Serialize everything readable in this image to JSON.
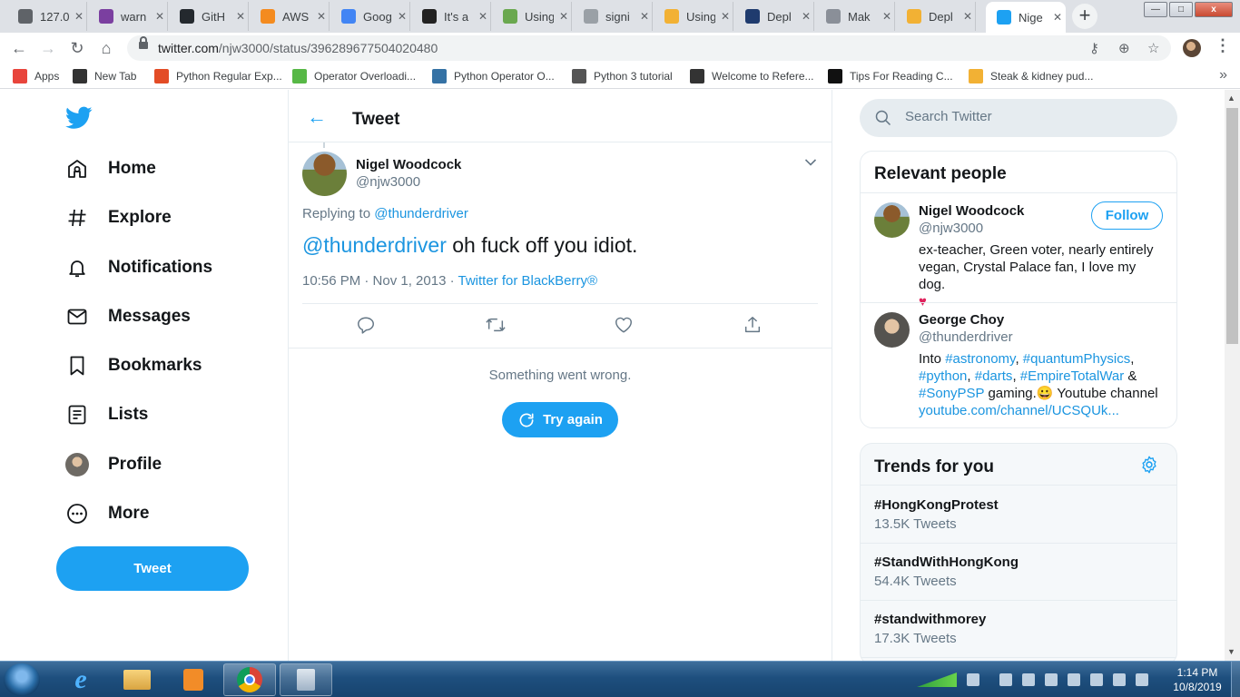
{
  "browser": {
    "tabs": [
      {
        "title": "127.0",
        "color": "#5f6368"
      },
      {
        "title": "warn",
        "color": "#7b3fa0"
      },
      {
        "title": "GitH",
        "color": "#24292e"
      },
      {
        "title": "AWS",
        "color": "#f48b1f"
      },
      {
        "title": "Goog",
        "color": "#4285f4"
      },
      {
        "title": "It's a",
        "color": "#222222"
      },
      {
        "title": "Using",
        "color": "#6aa84f"
      },
      {
        "title": "signi",
        "color": "#9aa0a6"
      },
      {
        "title": "Using",
        "color": "#f2b134"
      },
      {
        "title": "Depl",
        "color": "#1f3b6e"
      },
      {
        "title": "Mak",
        "color": "#8a8f98"
      },
      {
        "title": "Depl",
        "color": "#f2b134"
      },
      {
        "title": "Nige",
        "color": "#1da1f2"
      }
    ],
    "tab_close": "✕",
    "new_tab": "+",
    "url_host": "twitter.com",
    "url_path": "/njw3000/status/396289677504020480",
    "bookmarks": [
      {
        "label": "Apps",
        "color": "#e8453c"
      },
      {
        "label": "New Tab",
        "color": "#333333"
      },
      {
        "label": "Python Regular Exp...",
        "color": "#e34c26"
      },
      {
        "label": "Operator Overloadi...",
        "color": "#57b846"
      },
      {
        "label": "Python Operator O...",
        "color": "#3572a5"
      },
      {
        "label": "Python 3 tutorial",
        "color": "#555555"
      },
      {
        "label": "Welcome to Refere...",
        "color": "#333333"
      },
      {
        "label": "Tips For Reading C...",
        "color": "#111111"
      },
      {
        "label": "Steak & kidney pud...",
        "color": "#f2b134"
      }
    ],
    "bookmarks_overflow": "»"
  },
  "nav": {
    "items": [
      {
        "label": "Home",
        "icon": "home-icon"
      },
      {
        "label": "Explore",
        "icon": "hashtag-icon"
      },
      {
        "label": "Notifications",
        "icon": "bell-icon"
      },
      {
        "label": "Messages",
        "icon": "envelope-icon"
      },
      {
        "label": "Bookmarks",
        "icon": "bookmark-icon"
      },
      {
        "label": "Lists",
        "icon": "list-icon"
      },
      {
        "label": "Profile",
        "icon": "avatar"
      },
      {
        "label": "More",
        "icon": "more-icon"
      }
    ],
    "tweet_button": "Tweet"
  },
  "main": {
    "title": "Tweet",
    "tweet": {
      "name": "Nigel Woodcock",
      "handle": "@njw3000",
      "replying_prefix": "Replying to ",
      "replying_to": "@thunderdriver",
      "mention": "@thunderdriver",
      "text": " oh fuck off you idiot.",
      "time": "10:56 PM · Nov 1, 2013 · ",
      "source": "Twitter for BlackBerry®"
    },
    "error_text": "Something went wrong.",
    "try_again": "Try again"
  },
  "sidebar": {
    "search_placeholder": "Search Twitter",
    "relevant_title": "Relevant people",
    "people": [
      {
        "name": "Nigel Woodcock",
        "handle": "@njw3000",
        "follow_label": "Follow",
        "bio": "ex-teacher, Green voter, nearly entirely vegan, Crystal Palace fan, I love my dog.",
        "bio_emoji": "♥"
      },
      {
        "name": "George Choy",
        "handle": "@thunderdriver",
        "bio_prefix": "Into ",
        "tags": [
          "#astronomy",
          "#quantumPhysics",
          "#python",
          "#darts",
          "#EmpireTotalWar",
          "#SonyPSP"
        ],
        "bio_gaming": " gaming.",
        "bio_emoji": "😀",
        "bio_channel": " Youtube channel",
        "bio_link": "youtube.com/channel/UCSQUk..."
      }
    ],
    "trends_title": "Trends for you",
    "trends": [
      {
        "name": "#HongKongProtest",
        "count": "13.5K Tweets"
      },
      {
        "name": "#StandWithHongKong",
        "count": "54.4K Tweets"
      },
      {
        "name": "#standwithmorey",
        "count": "17.3K Tweets"
      }
    ]
  },
  "taskbar": {
    "time": "1:14 PM",
    "date": "10/8/2019"
  }
}
